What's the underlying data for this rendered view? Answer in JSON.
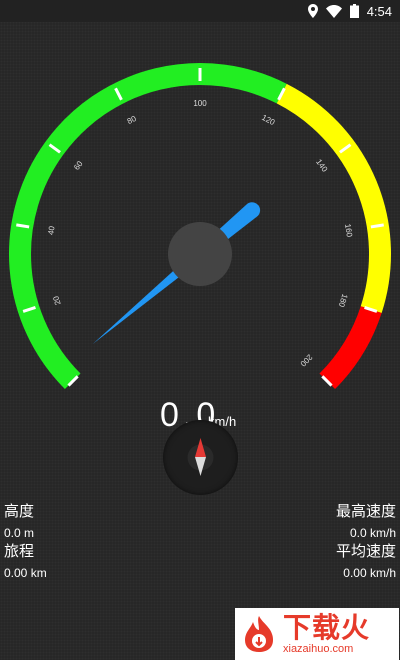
{
  "status_bar": {
    "time": "4:54",
    "icons": [
      "location-icon",
      "wifi-icon",
      "battery-icon"
    ]
  },
  "gauge": {
    "min": 0,
    "max": 200,
    "current_speed": 0,
    "tick_labels": [
      "20",
      "40",
      "60",
      "80",
      "100",
      "120",
      "140",
      "160",
      "180",
      "200"
    ],
    "zones": [
      {
        "from": 0,
        "to": 120,
        "color": "#22ee22"
      },
      {
        "from": 120,
        "to": 180,
        "color": "#ffff00"
      },
      {
        "from": 180,
        "to": 200,
        "color": "#ff0000"
      }
    ],
    "needle_color": "#2196f3",
    "hub_color": "#444444"
  },
  "readout": {
    "speed": "0.0",
    "unit": "km/h"
  },
  "stats": {
    "altitude_label": "高度",
    "altitude_value": "0.0 m",
    "distance_label": "旅程",
    "distance_value": "0.00 km",
    "max_speed_label": "最高速度",
    "max_speed_value": "0.0 km/h",
    "avg_speed_label": "平均速度",
    "avg_speed_value": "0.00 km/h"
  },
  "watermark": {
    "main": "下载火",
    "sub": "xiazaihuo.com"
  }
}
